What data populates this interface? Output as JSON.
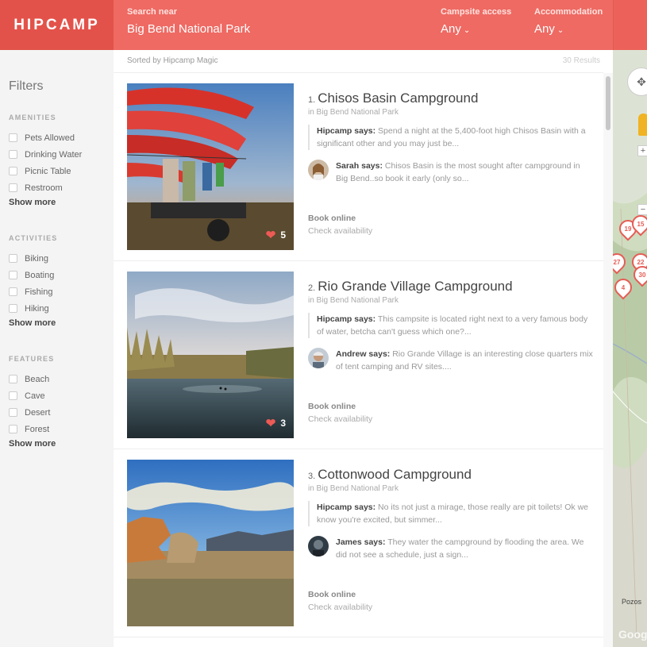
{
  "header": {
    "logo": "HIPCAMP",
    "search_label": "Search near",
    "search_value": "Big Bend National Park",
    "access_label": "Campsite access",
    "access_value": "Any",
    "accommodation_label": "Accommodation",
    "accommodation_value": "Any"
  },
  "sidebar": {
    "title": "Filters",
    "groups": [
      {
        "heading": "AMENITIES",
        "items": [
          "Pets Allowed",
          "Drinking Water",
          "Picnic Table",
          "Restroom"
        ],
        "show_more": "Show more"
      },
      {
        "heading": "ACTIVITIES",
        "items": [
          "Biking",
          "Boating",
          "Fishing",
          "Hiking"
        ],
        "show_more": "Show more"
      },
      {
        "heading": "FEATURES",
        "items": [
          "Beach",
          "Cave",
          "Desert",
          "Forest"
        ],
        "show_more": "Show more"
      }
    ]
  },
  "main": {
    "sort_text": "Sorted by Hipcamp Magic",
    "results_count": "30 Results",
    "cards": [
      {
        "number": "1.",
        "title": "Chisos Basin Campground",
        "location": "in Big Bend National Park",
        "likes": "5",
        "hipcamp_label": "Hipcamp says:",
        "hipcamp_text": "Spend a night at the 5,400-foot high Chisos Basin with a significant other and you may just be...",
        "reviewer_label": "Sarah says:",
        "reviewer_text": "Chisos Basin is the most sought after campground in Big Bend..so book it early (only so...",
        "book": "Book online",
        "check": "Check availability"
      },
      {
        "number": "2.",
        "title": "Rio Grande Village Campground",
        "location": "in Big Bend National Park",
        "likes": "3",
        "hipcamp_label": "Hipcamp says:",
        "hipcamp_text": "This campsite is located right next to a very famous body of water, betcha can't guess which one?...",
        "reviewer_label": "Andrew says:",
        "reviewer_text": "Rio Grande Village is an interesting close quarters mix of tent camping and RV sites....",
        "book": "Book online",
        "check": "Check availability"
      },
      {
        "number": "3.",
        "title": "Cottonwood Campground",
        "location": "in Big Bend National Park",
        "likes": "",
        "hipcamp_label": "Hipcamp says:",
        "hipcamp_text": "No its not just a mirage, those really are pit toilets! Ok we know you're excited, but simmer...",
        "reviewer_label": "James says:",
        "reviewer_text": "They water the campground by flooding the area. We did not see a schedule, just a sign...",
        "book": "Book online",
        "check": "Check availability"
      }
    ]
  },
  "map": {
    "pins": [
      "19",
      "15",
      "27",
      "22",
      "30",
      "4"
    ],
    "place_label": "Pozos",
    "attribution": "Goog"
  },
  "icons": {
    "heart": "heart-icon",
    "caret": "chevron-down-icon",
    "map_control": "pan-control-icon",
    "pegman": "street-view-icon"
  },
  "colors": {
    "brand": "#ee6a63",
    "brand_dark": "#e3524a",
    "heart": "#ee5a55"
  }
}
